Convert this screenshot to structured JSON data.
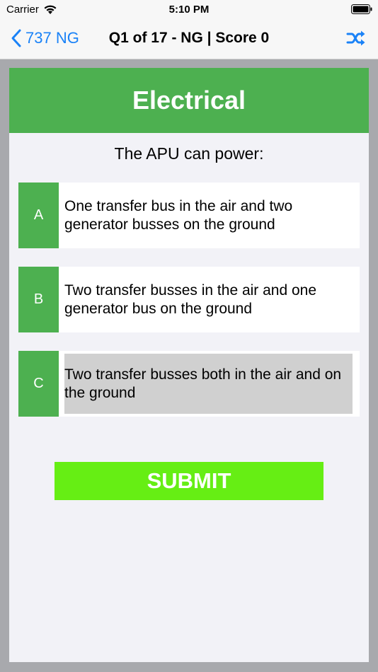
{
  "status_bar": {
    "carrier": "Carrier",
    "time": "5:10 PM"
  },
  "nav": {
    "back_label": "737 NG",
    "title": "Q1 of 17 - NG | Score 0",
    "accent_color": "#1a82f7"
  },
  "quiz": {
    "category": "Electrical",
    "question": "The APU can power:",
    "options": [
      {
        "letter": "A",
        "text": "One transfer bus in the air and two generator busses on the ground",
        "selected": false
      },
      {
        "letter": "B",
        "text": "Two transfer busses in the air and one generator bus on the ground",
        "selected": false
      },
      {
        "letter": "C",
        "text": "Two transfer busses both in the air and on the ground",
        "selected": true
      }
    ],
    "submit_label": "SUBMIT"
  },
  "colors": {
    "category_green": "#4db050",
    "submit_green": "#66ee14",
    "selected_gray": "#d0d0d0"
  }
}
